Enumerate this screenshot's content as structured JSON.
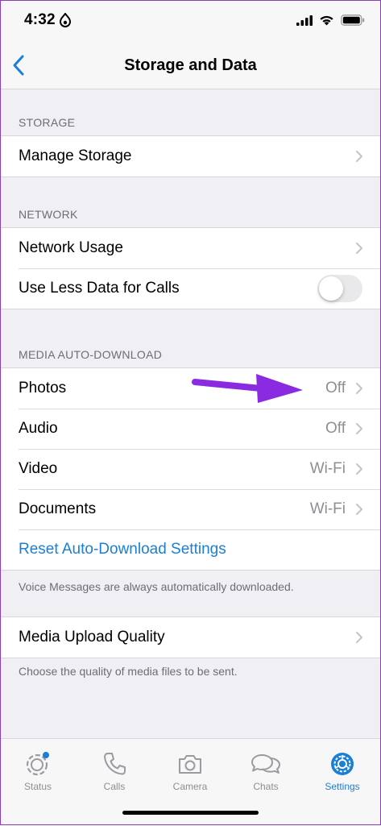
{
  "status_bar": {
    "time": "4:32"
  },
  "nav": {
    "title": "Storage and Data"
  },
  "storage": {
    "header": "STORAGE",
    "manage_storage": "Manage Storage"
  },
  "network": {
    "header": "NETWORK",
    "network_usage": "Network Usage",
    "use_less_data": "Use Less Data for Calls",
    "use_less_data_on": false
  },
  "media_auto_download": {
    "header": "MEDIA AUTO-DOWNLOAD",
    "rows": [
      {
        "label": "Photos",
        "value": "Off"
      },
      {
        "label": "Audio",
        "value": "Off"
      },
      {
        "label": "Video",
        "value": "Wi-Fi"
      },
      {
        "label": "Documents",
        "value": "Wi-Fi"
      }
    ],
    "reset": "Reset Auto-Download Settings",
    "note": "Voice Messages are always automatically downloaded."
  },
  "upload": {
    "label": "Media Upload Quality",
    "note": "Choose the quality of media files to be sent."
  },
  "tabs": [
    {
      "label": "Status",
      "icon": "status-icon"
    },
    {
      "label": "Calls",
      "icon": "phone-icon"
    },
    {
      "label": "Camera",
      "icon": "camera-icon"
    },
    {
      "label": "Chats",
      "icon": "chat-bubbles-icon"
    },
    {
      "label": "Settings",
      "icon": "gear-icon",
      "active": true
    }
  ],
  "colors": {
    "accent": "#1a7fd6",
    "annotation_arrow": "#8a2be2",
    "background": "#efeff4"
  }
}
